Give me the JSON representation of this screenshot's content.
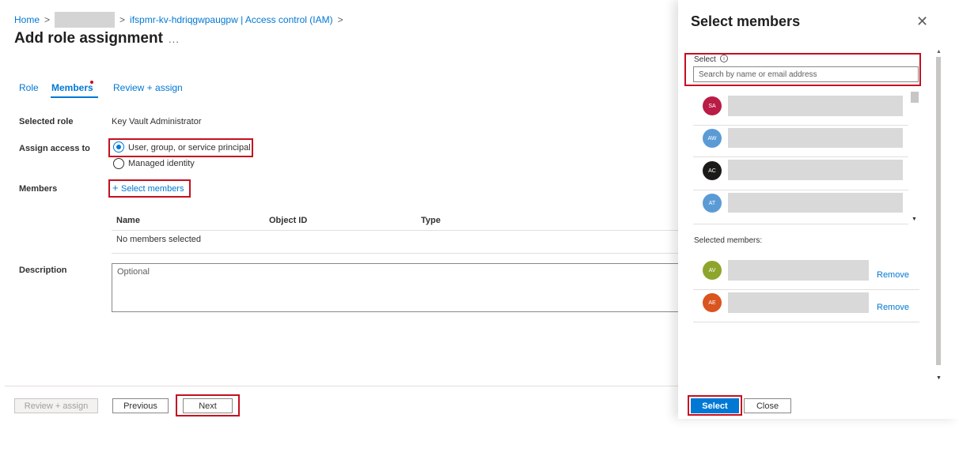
{
  "breadcrumb": {
    "home": "Home",
    "separator": ">",
    "resource": "ifspmr-kv-hdriqgwpaugpw | Access control (IAM)"
  },
  "page": {
    "title": "Add role assignment",
    "more": "..."
  },
  "tabs": [
    {
      "label": "Role"
    },
    {
      "label": "Members"
    },
    {
      "label": "Review + assign"
    }
  ],
  "form": {
    "selected_role_label": "Selected role",
    "selected_role_value": "Key Vault Administrator",
    "assign_access_label": "Assign access to",
    "assign_options": [
      {
        "label": "User, group, or service principal",
        "checked": true
      },
      {
        "label": "Managed identity",
        "checked": false
      }
    ],
    "members_label": "Members",
    "select_members_link": "Select members",
    "select_members_plus": "+",
    "table_columns": [
      "Name",
      "Object ID",
      "Type"
    ],
    "no_members_text": "No members selected",
    "description_label": "Description",
    "description_placeholder": "Optional"
  },
  "footer": {
    "review_assign": "Review + assign",
    "previous": "Previous",
    "next": "Next"
  },
  "panel": {
    "title": "Select members",
    "close_glyph": "✕",
    "select_label": "Select",
    "info_glyph": "i",
    "search_placeholder": "Search by name or email address",
    "candidates": [
      {
        "initials": "SA",
        "color": "#b91c45"
      },
      {
        "initials": "AW",
        "color": "#5b9bd5"
      },
      {
        "initials": "AC",
        "color": "#1b1a19"
      },
      {
        "initials": "AT",
        "color": "#5b9bd5"
      }
    ],
    "selected_members_label": "Selected members:",
    "selected": [
      {
        "initials": "AV",
        "color": "#8ea52c",
        "remove": "Remove"
      },
      {
        "initials": "AE",
        "color": "#d9541e",
        "remove": "Remove"
      }
    ],
    "select_button": "Select",
    "close_button": "Close"
  },
  "colors": {
    "accent": "#0078d4",
    "highlight_box": "#c50f1f"
  }
}
